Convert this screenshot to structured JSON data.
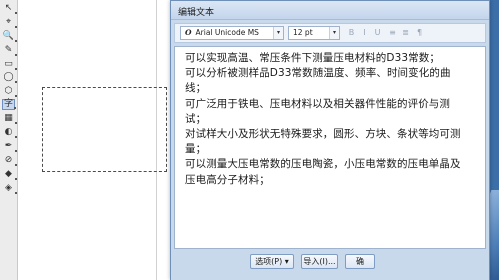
{
  "dialog": {
    "title": "编辑文本",
    "font_name": "Arial Unicode MS",
    "font_type_glyph": "O",
    "font_size": "12 pt",
    "dropdown_arrow": "▾",
    "format_icons": [
      "B",
      "I",
      "U",
      "≡",
      "≣",
      "¶"
    ],
    "text_lines": [
      "可以实现高温、常压条件下测量压电材料的D33常数；",
      "可以分析被测样品D33常数随温度、频率、时间变化的曲",
      "线；",
      "可广泛用于铁电、压电材料以及相关器件性能的评价与测",
      "试；",
      "对试样大小及形状无特殊要求，圆形、方块、条状等均可测",
      "量；",
      "可以测量大压电常数的压电陶瓷，小压电常数的压电单晶及",
      "压电高分子材料；"
    ],
    "buttons": {
      "options": "选项(P) ▾",
      "import": "导入(I)...",
      "ok": "确"
    }
  },
  "toolbox": {
    "tools": [
      "pick-tool",
      "shape-tool",
      "zoom-tool",
      "freehand-tool",
      "rectangle-tool",
      "ellipse-tool",
      "polygon-tool",
      "text-tool",
      "table-tool",
      "interactive-tool",
      "eyedropper-tool",
      "outline-tool",
      "fill-tool",
      "interactive-fill-tool"
    ],
    "tool_glyphs": [
      "↖",
      "⌖",
      "🔍",
      "✎",
      "▭",
      "◯",
      "⬡",
      "字",
      "▦",
      "◐",
      "✒",
      "⊘",
      "◆",
      "◈"
    ],
    "selected_tool": "text-tool"
  },
  "colors": {
    "dialog_bg": "#c9d9ec",
    "accent": "#3d6ea8"
  }
}
